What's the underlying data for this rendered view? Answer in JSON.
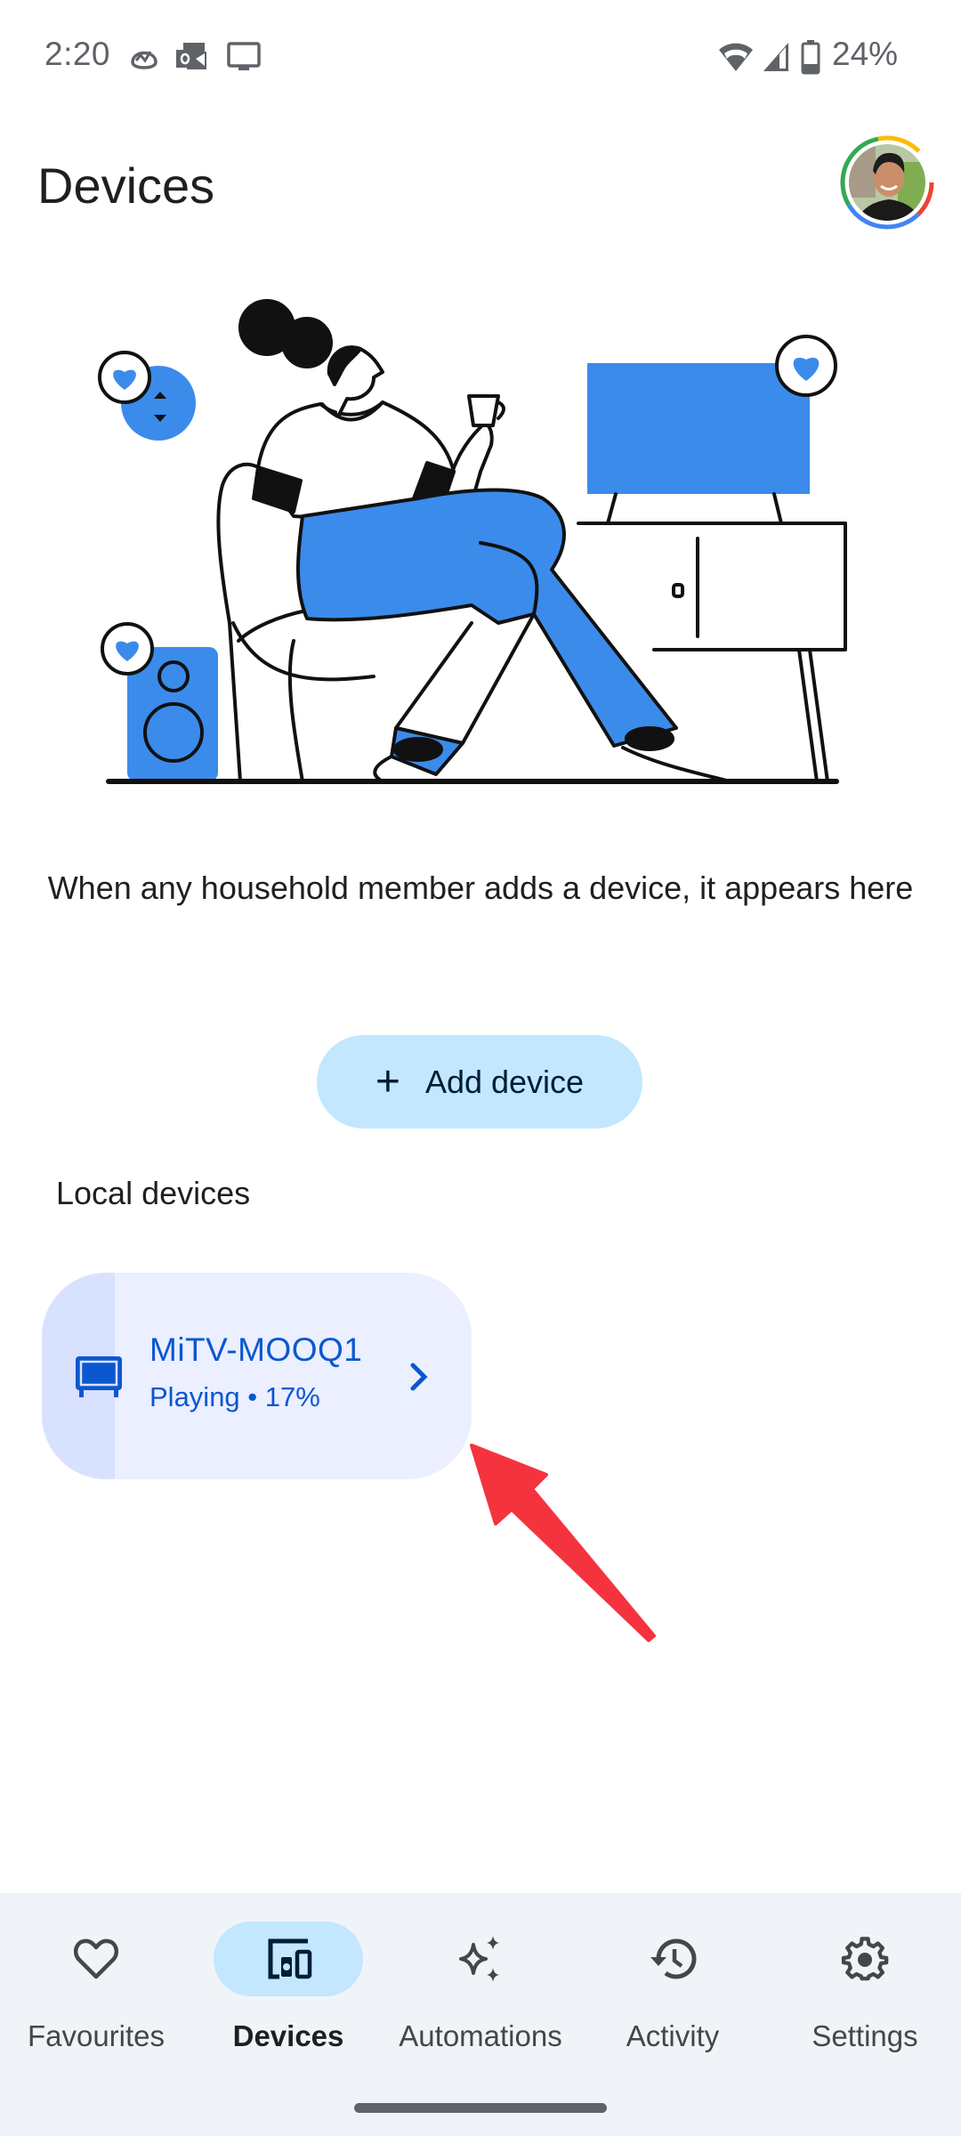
{
  "status_bar": {
    "time": "2:20",
    "left_icons": [
      "basecamp-icon",
      "outlook-icon",
      "cast-tv-icon"
    ],
    "right_icons": [
      "wifi-icon",
      "cell-signal-icon",
      "battery-icon"
    ],
    "battery": "24%"
  },
  "header": {
    "title": "Devices",
    "avatar": "account-avatar"
  },
  "illustration": {
    "description": "person relaxing in armchair with smart speaker, TV and display"
  },
  "empty_state": {
    "message": "When any household member adds a device, it appears here"
  },
  "add_device": {
    "icon": "plus-icon",
    "label": "Add device"
  },
  "local_devices": {
    "title": "Local devices",
    "items": [
      {
        "name": "MiTV-MOOQ1",
        "status": "Playing • 17%",
        "progress_percent": 17,
        "icon": "tv-icon"
      }
    ]
  },
  "annotation": {
    "arrow_color": "#f5333f"
  },
  "bottom_nav": {
    "items": [
      {
        "label": "Favourites",
        "icon": "heart-icon",
        "active": false
      },
      {
        "label": "Devices",
        "icon": "devices-icon",
        "active": true
      },
      {
        "label": "Automations",
        "icon": "sparkle-icon",
        "active": false
      },
      {
        "label": "Activity",
        "icon": "history-icon",
        "active": false
      },
      {
        "label": "Settings",
        "icon": "gear-icon",
        "active": false
      }
    ]
  },
  "colors": {
    "accent_blue": "#0b57d0",
    "button_bg": "#c2e7ff",
    "card_bg": "#ebefff",
    "card_progress": "#d8e2ff",
    "illustration_blue": "#3b8beb",
    "nav_bg": "#f0f4f9"
  }
}
